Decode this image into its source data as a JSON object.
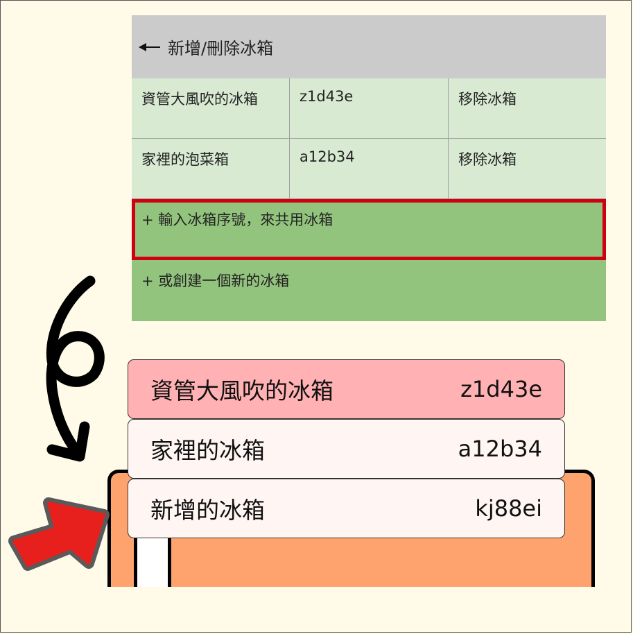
{
  "header": {
    "title": "新增/刪除冰箱",
    "back_icon": "back-arrow-icon"
  },
  "fridges": [
    {
      "name": "資管大風吹的冰箱",
      "code": "z1d43e",
      "action": "移除冰箱"
    },
    {
      "name": "家裡的泡菜箱",
      "code": "a12b34",
      "action": "移除冰箱"
    }
  ],
  "actions": {
    "join_shared": "+ 輸入冰箱序號，來共用冰箱",
    "create_new": "+ 或創建一個新的冰箱"
  },
  "illustration": {
    "cards": [
      {
        "name": "資管大風吹的冰箱",
        "code": "z1d43e"
      },
      {
        "name": "家裡的冰箱",
        "code": "a12b34"
      },
      {
        "name": "新增的冰箱",
        "code": "kj88ei"
      }
    ]
  },
  "colors": {
    "header_bg": "#cbcbcb",
    "row_bg": "#d9ead3",
    "action_bg": "#93c47d",
    "highlight_border": "#d0000f",
    "card_highlight": "#ffb1b3",
    "card_bg": "#fff5f3",
    "fridge_body": "#ffa36e",
    "pointer_red": "#e8201d"
  }
}
